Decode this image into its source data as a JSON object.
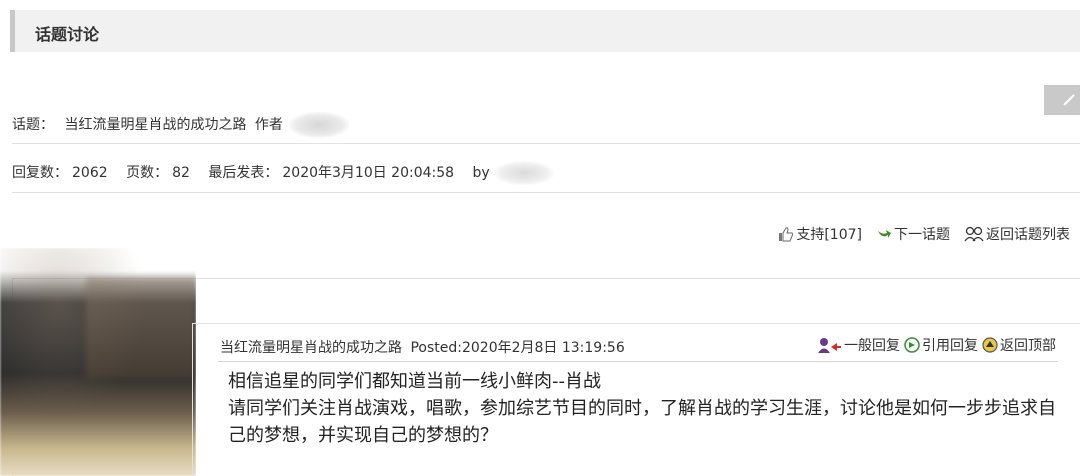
{
  "section": {
    "title": "话题讨论"
  },
  "topic": {
    "label": "话题：",
    "title": "当红流量明星肖战的成功之路",
    "author_label": "作者"
  },
  "stats": {
    "replies_label": "回复数：",
    "replies": "2062",
    "pages_label": "页数：",
    "pages": "82",
    "last_post_label": "最后发表：",
    "last_post_time": "2020年3月10日 20:04:58",
    "by_label": "by"
  },
  "actions": {
    "support": "支持[107]",
    "next_topic": "下一话题",
    "back_to_list": "返回话题列表"
  },
  "post": {
    "title": "当红流量明星肖战的成功之路",
    "posted_label": "Posted:",
    "posted_time": "2020年2月8日 13:19:56",
    "reply": "一般回复",
    "quote_reply": "引用回复",
    "back_to_top": "返回顶部",
    "body_line1": "相信追星的同学们都知道当前一线小鲜肉--肖战",
    "body_line2": "请同学们关注肖战演戏，唱歌，参加综艺节目的同时，了解肖战的学习生涯，讨论他是如何一步步追求自己的梦想，并实现自己的梦想的？"
  },
  "icons": {
    "support": "thumbs-up-icon",
    "next": "arrow-right-icon",
    "list": "users-icon",
    "reply": "user-reply-icon",
    "quote": "quote-arrow-icon",
    "top": "up-arrow-circle-icon",
    "side": "edit-pencil-icon"
  }
}
